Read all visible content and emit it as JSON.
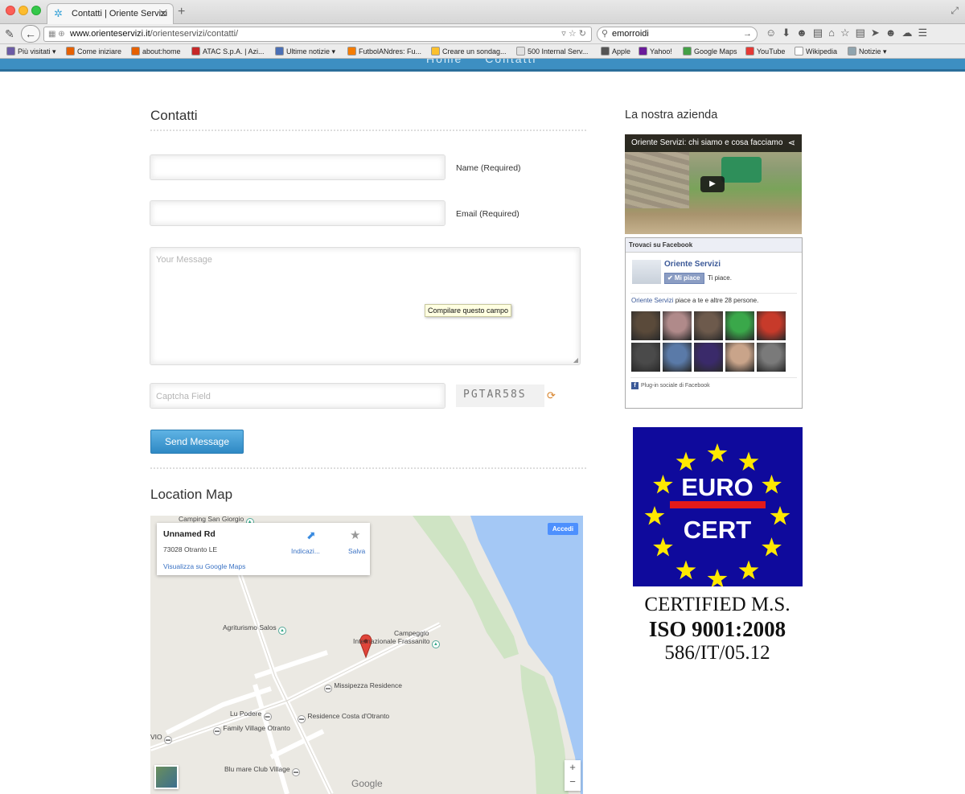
{
  "browser": {
    "tab_title": "Contatti | Oriente Servizi",
    "tab_close": "✕",
    "new_tab": "+",
    "url_domain": "www.orienteservizi.it",
    "url_path": "/orienteservizi/contatti/",
    "search_query": "emorroidi",
    "bookmarks": [
      {
        "label": "Più visitati ▾",
        "color": "#6b5ba5"
      },
      {
        "label": "Come iniziare",
        "color": "#e66000"
      },
      {
        "label": "about:home",
        "color": "#e66000"
      },
      {
        "label": "ATAC S.p.A. | Azi...",
        "color": "#c62828"
      },
      {
        "label": "Ultime notizie ▾",
        "color": "#4a6fb5"
      },
      {
        "label": "FutbolANdres: Fu...",
        "color": "#f57c00"
      },
      {
        "label": "Creare un sondag...",
        "color": "#fbc02d"
      },
      {
        "label": "500 Internal Serv...",
        "color": "#e0e0e0"
      },
      {
        "label": "Apple",
        "color": "#555555"
      },
      {
        "label": "Yahoo!",
        "color": "#6a1b9a"
      },
      {
        "label": "Google Maps",
        "color": "#43a047"
      },
      {
        "label": "YouTube",
        "color": "#e53935"
      },
      {
        "label": "Wikipedia",
        "color": "#ffffff"
      },
      {
        "label": "Notizie ▾",
        "color": "#90a4ae"
      }
    ]
  },
  "site_nav": "Home  Contatti",
  "contact": {
    "title": "Contatti",
    "name_label": "Name (Required)",
    "email_label": "Email (Required)",
    "message_placeholder": "Your Message",
    "validation_tooltip": "Compilare questo campo",
    "captcha_placeholder": "Captcha Field",
    "captcha_code": "PGTAR58S",
    "send_label": "Send Message"
  },
  "map": {
    "title": "Location Map",
    "place_name": "Unnamed Rd",
    "place_address": "73028 Otranto LE",
    "directions_label": "Indicazi...",
    "save_label": "Salva",
    "gmaps_link": "Visualizza su Google Maps",
    "signin_label": "Accedi",
    "logo": "Google",
    "zoom_in": "+",
    "zoom_out": "−",
    "labels": {
      "camping_top": "Camping San Giorgio",
      "agriturismo": "Agriturismo Salos",
      "campeggio_1": "Campeggio",
      "campeggio_2": "Internazionale Frassanito",
      "missipezza": "Missipezza Residence",
      "lu_podere": "Lu Podere",
      "costa": "Residence Costa d'Otranto",
      "family": "Family Village Otranto",
      "vio": "VIO",
      "blumare": "Blu mare Club Village"
    }
  },
  "sidebar": {
    "title": "La nostra azienda",
    "video_title": "Oriente Servizi: chi siamo e cosa facciamo",
    "facebook": {
      "header": "Trovaci su Facebook",
      "page_name": "Oriente Servizi",
      "like_button": "✔ Mi piace",
      "you_like": "Ti piace.",
      "count_link": "Oriente Servizi",
      "count_text": " piace a te e altre 28 persone.",
      "footer": "Plug-in sociale di Facebook",
      "face_colors": [
        "#5a4a3a",
        "#b08a8a",
        "#6d5a4c",
        "#3aa84a",
        "#c73a2a",
        "#4a4a4a",
        "#5a7aa8",
        "#3a2a6a",
        "#c9a48a",
        "#7a7a7a"
      ]
    },
    "cert": {
      "euro": "EURO",
      "cert": "CERT",
      "line1": "CERTIFIED M.S.",
      "line2": "ISO 9001:2008",
      "line3": "586/IT/05.12"
    }
  }
}
